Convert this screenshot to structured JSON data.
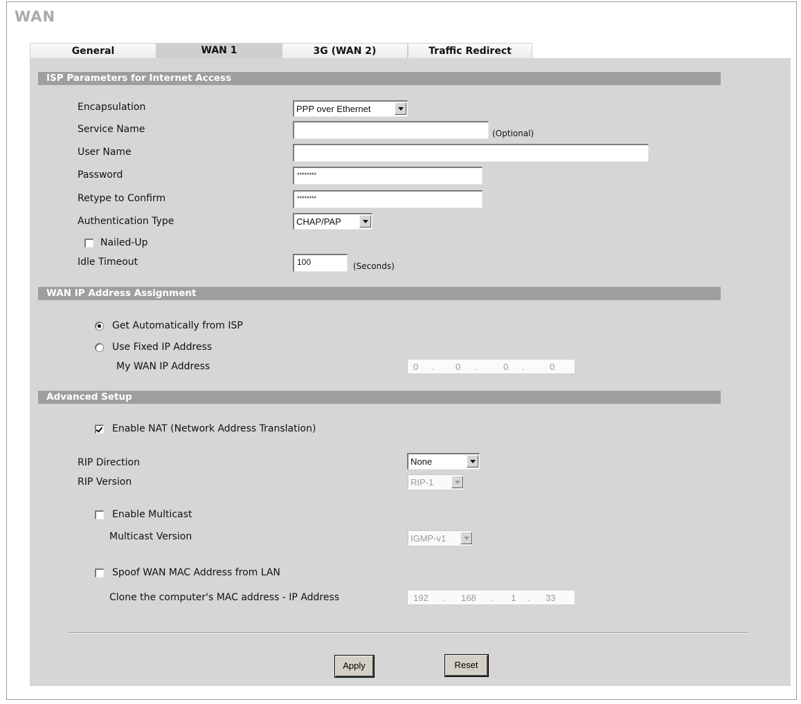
{
  "page": {
    "title": "WAN"
  },
  "tabs": [
    {
      "label": "General",
      "active": false
    },
    {
      "label": "WAN 1",
      "active": true
    },
    {
      "label": "3G (WAN 2)",
      "active": false
    },
    {
      "label": "Traffic Redirect",
      "active": false
    }
  ],
  "isp": {
    "heading": "ISP Parameters for Internet Access",
    "encapsulation_label": "Encapsulation",
    "encapsulation_value": "PPP over Ethernet",
    "service_name_label": "Service Name",
    "service_name_value": "",
    "optional_hint": "(Optional)",
    "user_name_label": "User Name",
    "user_name_value": "",
    "password_label": "Password",
    "password_value": "********",
    "retype_label": "Retype to Confirm",
    "retype_value": "********",
    "auth_type_label": "Authentication Type",
    "auth_type_value": "CHAP/PAP",
    "nailed_up_label": "Nailed-Up",
    "nailed_up_checked": false,
    "idle_timeout_label": "Idle Timeout",
    "idle_timeout_value": "100",
    "seconds_hint": "(Seconds)"
  },
  "wan_ip": {
    "heading": "WAN IP Address Assignment",
    "auto_label": "Get Automatically from ISP",
    "auto_selected": true,
    "fixed_label": "Use Fixed IP Address",
    "fixed_selected": false,
    "my_wan_ip_label": "My WAN IP Address",
    "my_wan_ip": [
      "0",
      "0",
      "0",
      "0"
    ]
  },
  "advanced": {
    "heading": "Advanced Setup",
    "nat_label": "Enable NAT (Network Address Translation)",
    "nat_checked": true,
    "rip_direction_label": "RIP Direction",
    "rip_direction_value": "None",
    "rip_version_label": "RIP Version",
    "rip_version_value": "RIP-1",
    "multicast_label": "Enable Multicast",
    "multicast_checked": false,
    "multicast_version_label": "Multicast Version",
    "multicast_version_value": "IGMP-v1",
    "spoof_label": "Spoof WAN MAC Address from LAN",
    "spoof_checked": false,
    "clone_label": "Clone the computer's MAC address - IP Address",
    "clone_ip": [
      "192",
      "168",
      "1",
      "33"
    ]
  },
  "buttons": {
    "apply_label": "Apply",
    "reset_label": "Reset"
  },
  "ip_separator": "."
}
